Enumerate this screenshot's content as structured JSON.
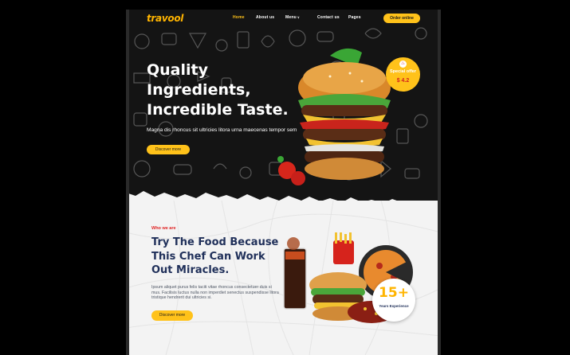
{
  "brand": {
    "logo_text": "travool",
    "accent": "#ffc21a",
    "red": "#e02424",
    "navy": "#20305a"
  },
  "nav": {
    "items": [
      {
        "label": "Home",
        "active": true
      },
      {
        "label": "About us",
        "active": false
      },
      {
        "label": "Menu",
        "active": false,
        "dropdown": true
      },
      {
        "label": "Contact us",
        "active": false
      },
      {
        "label": "Pages",
        "active": false
      }
    ],
    "order_button": "Order online"
  },
  "hero": {
    "headline_lines": [
      "Quality",
      "Ingredients,",
      "Incredible Taste."
    ],
    "subtext": "Magna dis rhoncus sit ultricies litora urna maecenas tempor sem",
    "cta": "Discover more",
    "offer": {
      "label": "Special offer",
      "price": "$ 4.2",
      "icon": "flame-icon"
    }
  },
  "about": {
    "eyebrow": "Who we are",
    "headline_lines": [
      "Try The Food Because",
      "This Chef Can Work",
      "Out Miracles."
    ],
    "paragraph": "Ipsum aliquet purus felis taciti vitae rhoncus consectetuer duis si mus. Facilisis luctus nulla non imperdiet senectus suspendisse litora tristique hendrerit dui ultricies si.",
    "cta": "Discover more",
    "experience": {
      "number": "15+",
      "label": "Years Experience"
    }
  }
}
